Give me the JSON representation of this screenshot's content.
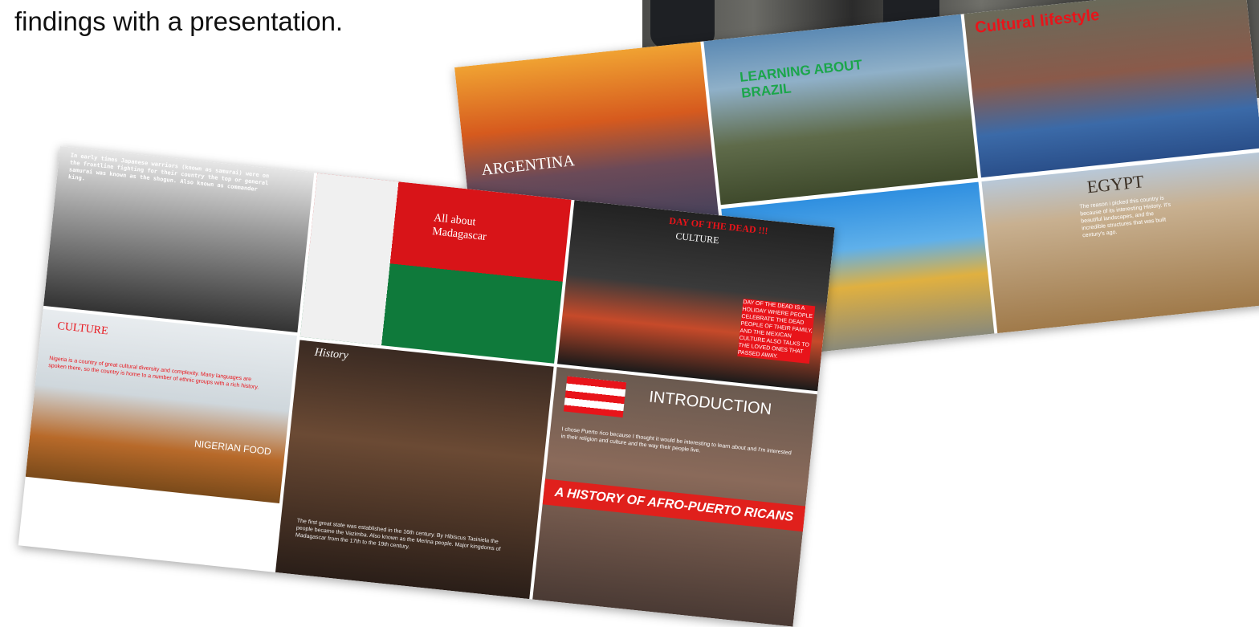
{
  "intro_text": "findings with a presentation.",
  "slides": {
    "argentina": "ARGENTINA",
    "brazil_heading": "LEARNING ABOUT BRAZIL",
    "cultural_lifestyle": "Cultural lifestyle",
    "egypt": "EGYPT",
    "egypt_text": "The reason i picked this country is because of its interesting History. It's beautiful landscapes, and the incredible structures that was built century's ago.",
    "japan_text": "In early times Japanese warriors (known as samurai) were on the frontline fighting for their country the top or general samurai was known as the shogun. Also known as commander king.",
    "culture": "CULTURE",
    "nigeria_text": "Nigeria is a country of great cultural diversity and complexity. Many languages are spoken there, so the country is home to a number of ethnic groups with a rich history.",
    "nigerian_food": "NIGERIAN FOOD",
    "madagascar_title": "All about Madagascar",
    "history": "History",
    "madagascar_text": "The first great state was established in the 16th century. By Hibiscus Tasiniela the people became the Vazimba. Also known as the Merina people. Major kingdoms of Madagascar from the 17th to the 19th century.",
    "day_of_dead_title": "DAY OF THE DEAD !!!",
    "day_of_dead_culture": "CULTURE",
    "day_of_dead_text": "DAY OF THE DEAD IS A HOLIDAY WHERE PEOPLE CELEBRATE THE DEAD PEOPLE OF THEIR FAMILY, AND THE MEXICAN CULTURE ALSO TALKS TO THE LOVED ONES THAT PASSED AWAY.",
    "introduction": "INTRODUCTION",
    "puerto_rico_text": "I chose Puerto rico because I thought it would be interesting to learn about and I'm interested in their religion and culture and the way their people live.",
    "puerto_rico_banner": "A HISTORY OF AFRO-PUERTO RICANS"
  },
  "colors": {
    "madagascar_red": "#d81418",
    "madagascar_green": "#0f7a3b",
    "banner_red": "#e0201c",
    "brazil_green": "#1aa64a",
    "cultural_red": "#e8141a"
  }
}
